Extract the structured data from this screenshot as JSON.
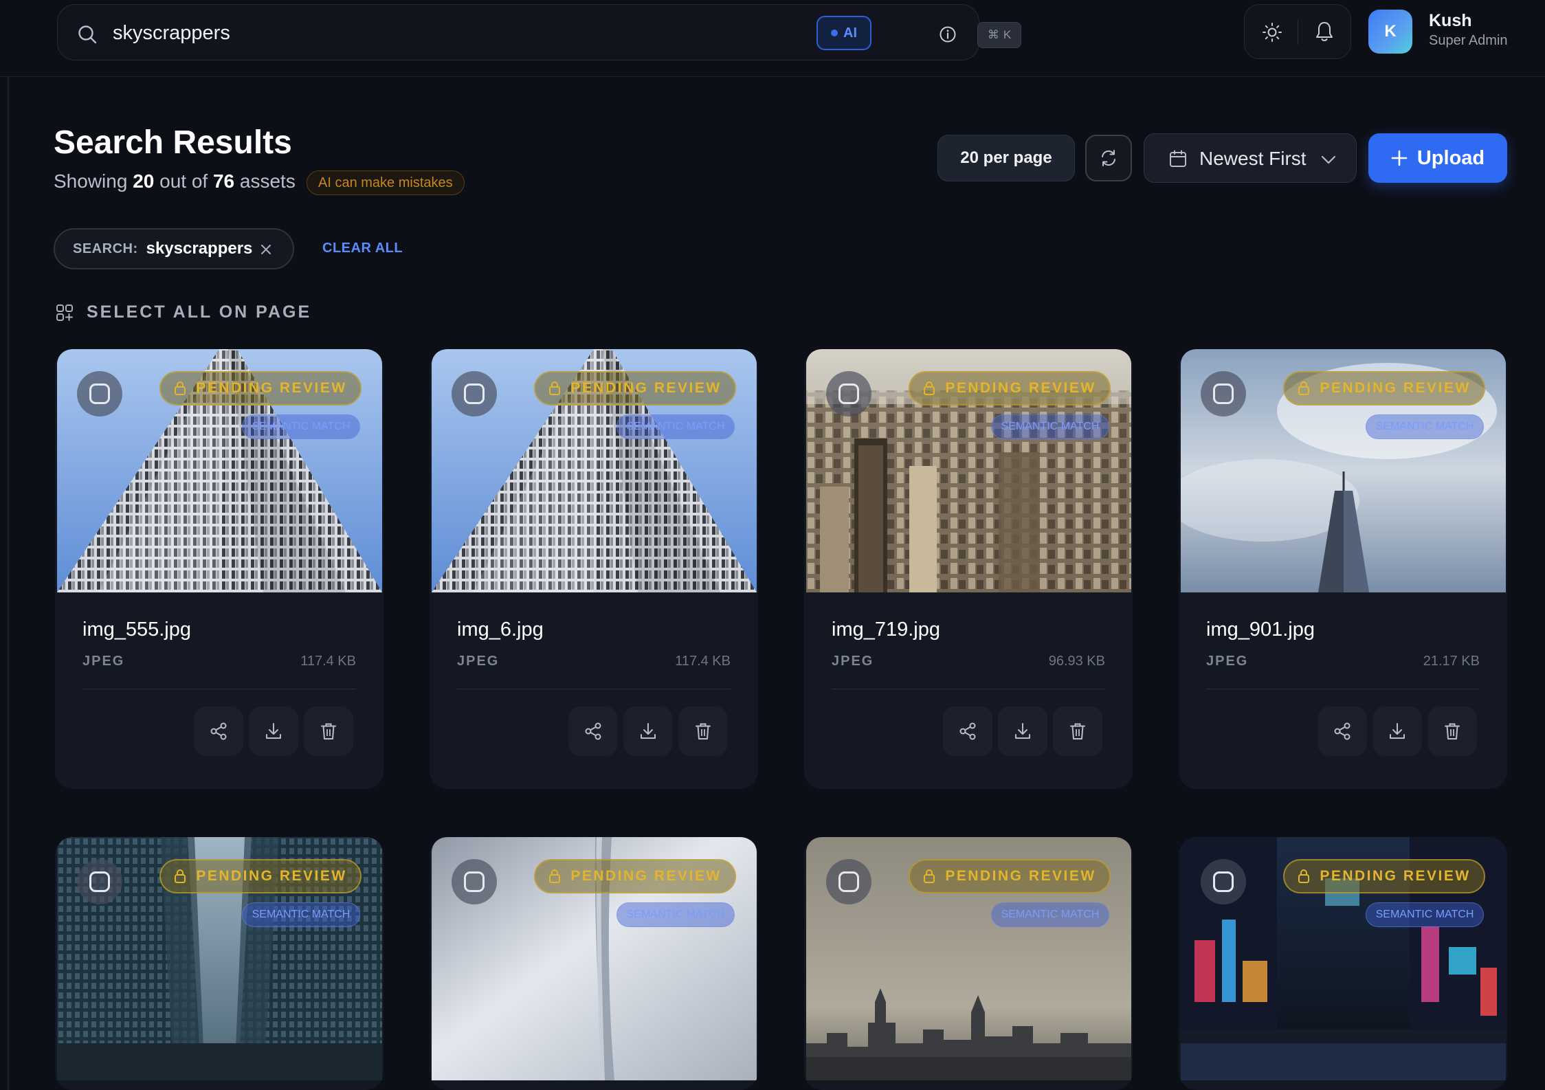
{
  "search": {
    "query": "skyscrappers",
    "ai_label": "AI",
    "shortcut_symbol": "⌘",
    "shortcut_key": "K"
  },
  "user": {
    "initial": "K",
    "name": "Kush",
    "role": "Super Admin"
  },
  "header": {
    "title": "Search Results",
    "showing_prefix": "Showing",
    "showing_count": "20",
    "showing_mid": "out of",
    "total_count": "76",
    "showing_suffix": "assets",
    "ai_warning": "AI can make mistakes"
  },
  "toolbar": {
    "per_page": "20 per page",
    "sort": "Newest First",
    "upload": "Upload"
  },
  "filters": {
    "chip_key": "SEARCH:",
    "chip_value": "skyscrappers",
    "clear_all": "CLEAR ALL",
    "select_all": "SELECT ALL ON PAGE"
  },
  "badges": {
    "pending": "PENDING REVIEW",
    "semantic": "SEMANTIC MATCH"
  },
  "cards": [
    {
      "name": "img_555.jpg",
      "type": "JPEG",
      "size": "117.4 KB",
      "image": "tower-lookup"
    },
    {
      "name": "img_6.jpg",
      "type": "JPEG",
      "size": "117.4 KB",
      "image": "tower-lookup"
    },
    {
      "name": "img_719.jpg",
      "type": "JPEG",
      "size": "96.93 KB",
      "image": "city-aerial"
    },
    {
      "name": "img_901.jpg",
      "type": "JPEG",
      "size": "21.17 KB",
      "image": "tower-spire-clouds"
    },
    {
      "name": "",
      "type": "",
      "size": "",
      "image": "street-canyon"
    },
    {
      "name": "",
      "type": "",
      "size": "",
      "image": "arch-sky"
    },
    {
      "name": "",
      "type": "",
      "size": "",
      "image": "skyline-haze"
    },
    {
      "name": "",
      "type": "",
      "size": "",
      "image": "neon-street"
    }
  ],
  "colors": {
    "background": "#0d0f17",
    "card": "#141822",
    "accent_blue": "#2f6bf2",
    "pending_gold": "#e4b52b",
    "semantic_blue": "#7b9cff"
  }
}
